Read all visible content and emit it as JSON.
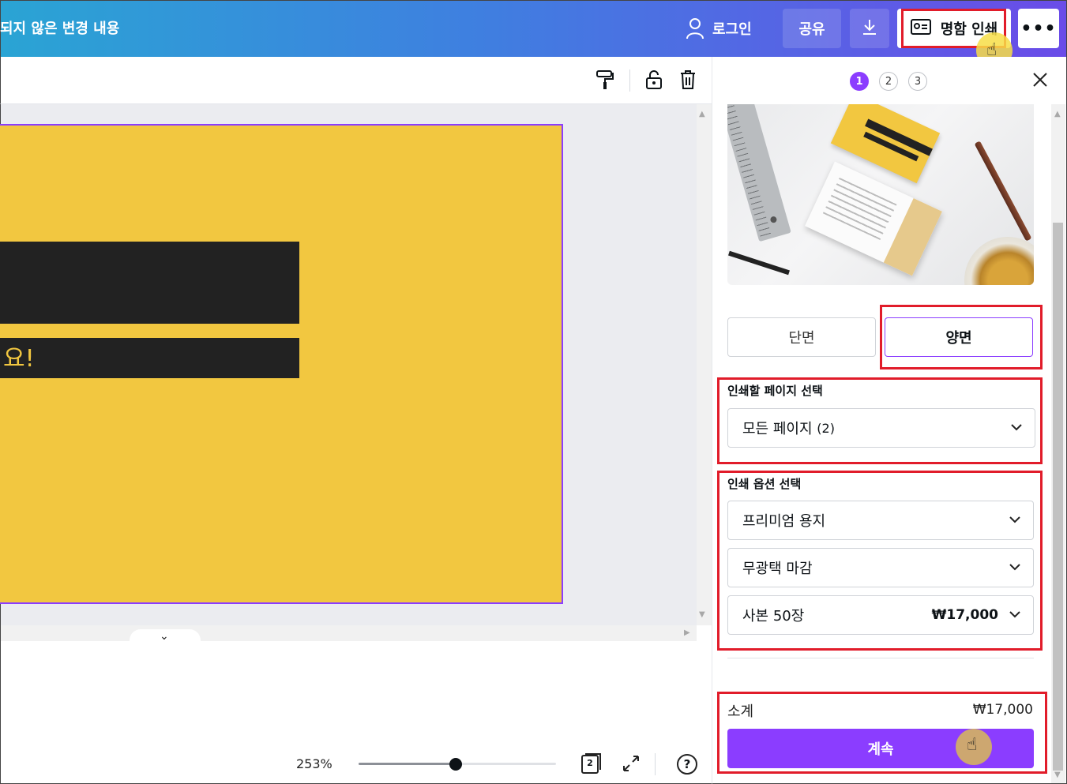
{
  "header": {
    "unsaved_text": "되지 않은 변경 내용",
    "login_label": "로그인",
    "share_label": "공유",
    "print_label": "명함 인쇄",
    "more_label": "•••"
  },
  "icons": {
    "toolbar": [
      "paint-roller-icon",
      "unlock-icon",
      "trash-icon"
    ],
    "header": [
      "user-icon",
      "download-icon",
      "business-card-icon",
      "more-icon"
    ]
  },
  "canvas": {
    "visible_text": "요!",
    "card_color": "#f2c740",
    "bar_color": "#222222",
    "selection_color": "#8b3dff"
  },
  "footer": {
    "zoom_label": "253%",
    "zoom_fraction": 0.49,
    "page_count": "2",
    "help_label": "?"
  },
  "panel": {
    "steps": [
      "1",
      "2",
      "3"
    ],
    "active_step": "1",
    "sides": {
      "single": "단면",
      "double": "양면",
      "selected": "double"
    },
    "pages_section": {
      "label": "인쇄할 페이지 선택",
      "value": "모든 페이지",
      "count": "(2)"
    },
    "options_section": {
      "label": "인쇄 옵션 선택",
      "paper": "프리미엄 용지",
      "finish": "무광택 마감",
      "copies": "사본 50장",
      "copies_price": "₩17,000"
    },
    "subtotal_label": "소계",
    "subtotal_value": "₩17,000",
    "continue_label": "계속"
  },
  "colors": {
    "accent": "#8b3dff",
    "highlight_box": "#e11c2a",
    "header_gradient_start": "#2aa4d4",
    "header_gradient_end": "#6a4ce8"
  }
}
